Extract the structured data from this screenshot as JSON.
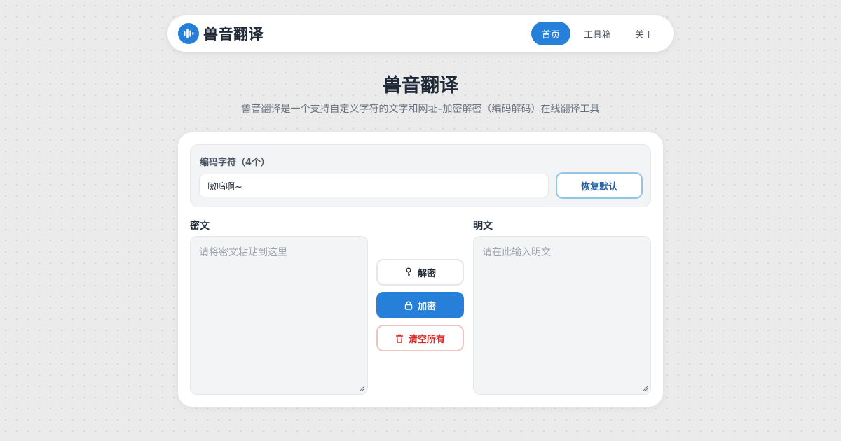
{
  "header": {
    "brand_name": "兽音翻译",
    "logo_icon": "sound-wave-icon",
    "nav": [
      {
        "label": "首页",
        "active": true
      },
      {
        "label": "工具箱",
        "active": false
      },
      {
        "label": "关于",
        "active": false
      }
    ]
  },
  "hero": {
    "title": "兽音翻译",
    "subtitle": "兽音翻译是一个支持自定义字符的文字和网址–加密解密（编码解码）在线翻译工具"
  },
  "charset": {
    "label": "编码字符（4个）",
    "value": "嗷呜啊~",
    "reset_label": "恢复默认"
  },
  "cipher": {
    "label": "密文",
    "placeholder": "请将密文粘贴到这里"
  },
  "plain": {
    "label": "明文",
    "placeholder": "请在此输入明文"
  },
  "actions": {
    "decrypt_label": "解密",
    "decrypt_icon": "key-icon",
    "encrypt_label": "加密",
    "encrypt_icon": "lock-icon",
    "clear_label": "清空所有",
    "clear_icon": "trash-icon"
  },
  "colors": {
    "accent": "#2680d9",
    "danger": "#dc2626",
    "background": "#ebebeb"
  }
}
